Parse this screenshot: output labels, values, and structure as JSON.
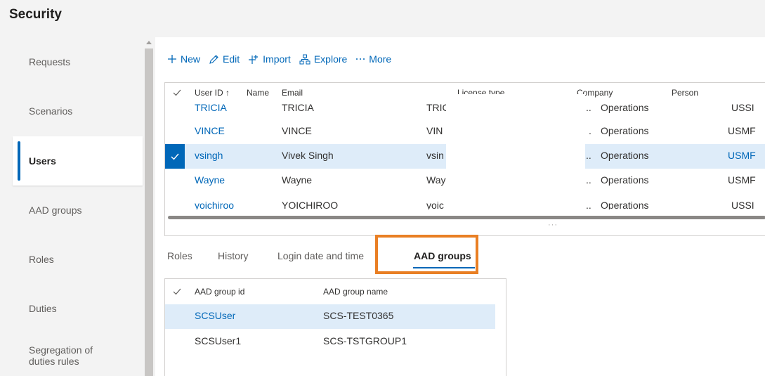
{
  "page": {
    "title": "Security"
  },
  "sidebar": {
    "items": [
      {
        "label": "Requests",
        "selected": false
      },
      {
        "label": "Scenarios",
        "selected": false
      },
      {
        "label": "Users",
        "selected": true
      },
      {
        "label": "AAD groups",
        "selected": false
      },
      {
        "label": "Roles",
        "selected": false
      },
      {
        "label": "Duties",
        "selected": false
      },
      {
        "label_line1": "Segregation of",
        "label_line2": "duties rules",
        "selected": false
      }
    ]
  },
  "toolbar": {
    "new_label": "New",
    "edit_label": "Edit",
    "import_label": "Import",
    "explore_label": "Explore",
    "more_label": "More"
  },
  "users_grid": {
    "headers": {
      "user_id": "User ID",
      "sort_indicator": "↑",
      "name": "Name",
      "email": "Email",
      "license_type": "License type",
      "company": "Company",
      "person": "Person"
    },
    "rows": [
      {
        "user_id": "TRICIA",
        "name": "TRICIA",
        "email": "TRIC",
        "license_prefix": "..",
        "license": "Operations",
        "company": "USSI",
        "selected": false
      },
      {
        "user_id": "VINCE",
        "name": "VINCE",
        "email": "VIN",
        "license_prefix": ".",
        "license": "Operations",
        "company": "USMF",
        "selected": false
      },
      {
        "user_id": "vsingh",
        "name": "Vivek Singh",
        "email": "vsin",
        "license_prefix": "..",
        "license": "Operations",
        "company": "USMF",
        "selected": true
      },
      {
        "user_id": "Wayne",
        "name": "Wayne",
        "email": "Way",
        "license_prefix": "..",
        "license": "Operations",
        "company": "USMF",
        "selected": false
      },
      {
        "user_id": "yoichiroo",
        "name": "YOICHIROO",
        "email": "yoic",
        "license_prefix": "..",
        "license": "Operations",
        "company": "USSI",
        "selected": false
      }
    ],
    "more_dots": "···"
  },
  "tabs": [
    {
      "label": "Roles",
      "active": false
    },
    {
      "label": "History",
      "active": false
    },
    {
      "label": "Login date and time",
      "active": false
    },
    {
      "label": "AAD groups",
      "active": true
    }
  ],
  "aad_groups_grid": {
    "headers": {
      "group_id": "AAD group id",
      "group_name": "AAD group name"
    },
    "rows": [
      {
        "group_id": "SCSUser",
        "group_name": "SCS-TEST0365",
        "selected": true
      },
      {
        "group_id": "SCSUser1",
        "group_name": "SCS-TSTGROUP1",
        "selected": false
      }
    ]
  },
  "colors": {
    "accent": "#0067b8",
    "selection": "#deecf9",
    "highlight": "#e97f24"
  }
}
